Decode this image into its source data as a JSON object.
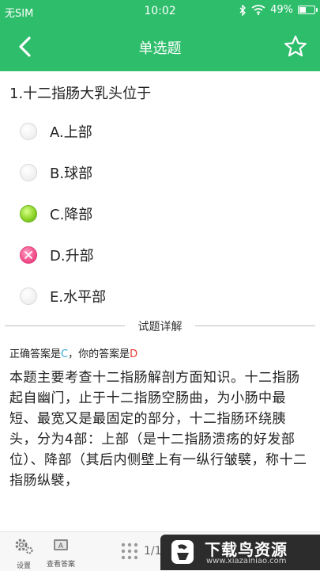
{
  "status_bar": {
    "carrier": "无SIM",
    "time": "10:02",
    "battery": "49%",
    "battery_level": 0.49
  },
  "header": {
    "title": "单选题"
  },
  "question": {
    "text": "1.十二指肠大乳头位于",
    "options": [
      {
        "label": "A.上部",
        "state": "empty"
      },
      {
        "label": "B.球部",
        "state": "empty"
      },
      {
        "label": "C.降部",
        "state": "correct"
      },
      {
        "label": "D.升部",
        "state": "wrong"
      },
      {
        "label": "E.水平部",
        "state": "empty"
      }
    ]
  },
  "details": {
    "section_title": "试题详解",
    "correct_prefix": "正确答案是",
    "correct_answer": "C",
    "your_prefix": "，你的答案是",
    "your_answer": "D",
    "explanation": "本题主要考查十二指肠解剖方面知识。十二指肠起自幽门，止于十二指肠空肠曲，为小肠中最短、最宽又是最固定的部分，十二指肠环绕胰头，分为4部：上部（是十二指肠溃疡的好发部位）、降部（其后内侧壁上有一纵行皱襞，称十二指肠纵襞，"
  },
  "bottom_bar": {
    "settings_label": "设置",
    "view_answer_label": "查看答案",
    "page_indicator": "1/1"
  },
  "watermark": {
    "name": "下载鸟资源",
    "url": "www.xiazainiao.com"
  },
  "colors": {
    "primary": "#2ebd6b",
    "correct_letter": "#39a9e0",
    "wrong_letter": "#e53935"
  },
  "icons": {
    "back": "back-chevron-icon",
    "favorite": "star-outline-icon",
    "settings": "gear-icon",
    "answer": "answer-card-icon",
    "grid": "grid-dots-icon"
  }
}
